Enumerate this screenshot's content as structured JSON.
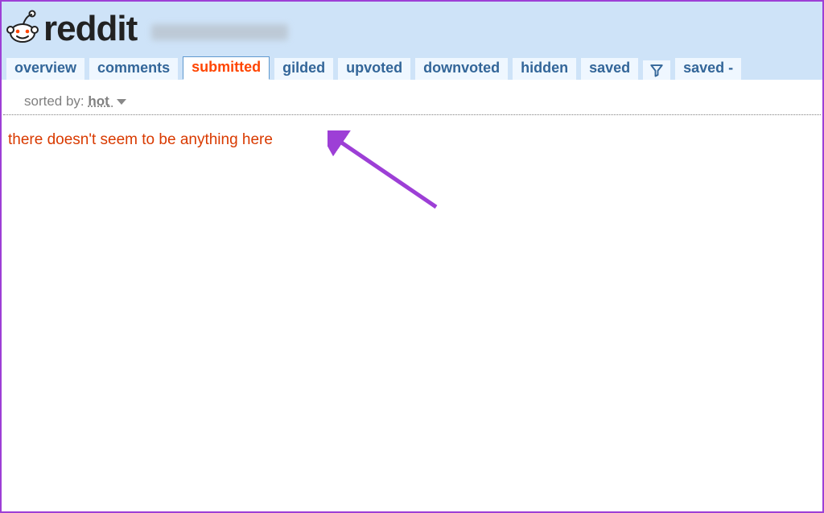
{
  "header": {
    "wordmark": "reddit"
  },
  "tabs": {
    "overview": "overview",
    "comments": "comments",
    "submitted": "submitted",
    "gilded": "gilded",
    "upvoted": "upvoted",
    "downvoted": "downvoted",
    "hidden": "hidden",
    "saved": "saved",
    "saved_filter": "saved - "
  },
  "sort": {
    "label": "sorted by: ",
    "value": "hot"
  },
  "empty_message": "there doesn't seem to be anything here"
}
